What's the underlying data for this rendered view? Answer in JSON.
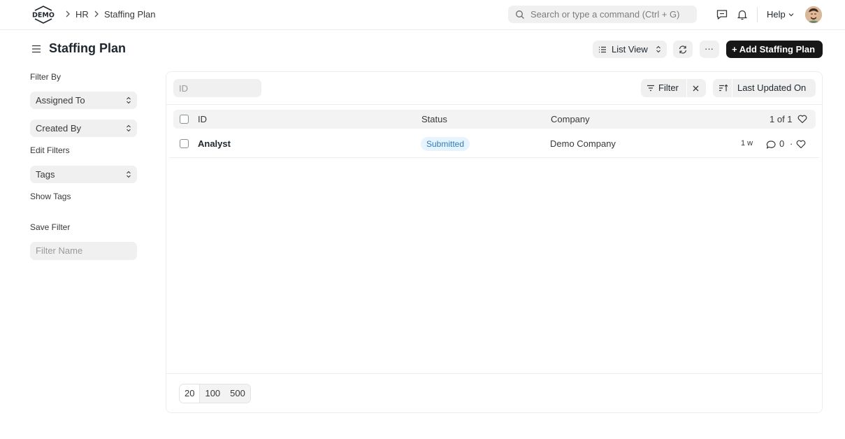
{
  "navbar": {
    "logo_text": "DEMO",
    "breadcrumbs": [
      "HR",
      "Staffing Plan"
    ],
    "search_placeholder": "Search or type a command (Ctrl + G)",
    "help_label": "Help"
  },
  "page": {
    "title": "Staffing Plan",
    "list_view_label": "List View",
    "more_label": "···",
    "add_button_label": "+ Add Staffing Plan"
  },
  "sidebar": {
    "filter_by_label": "Filter By",
    "assigned_to_label": "Assigned To",
    "created_by_label": "Created By",
    "edit_filters_label": "Edit Filters",
    "tags_label": "Tags",
    "show_tags_label": "Show Tags",
    "save_filter_label": "Save Filter",
    "filter_name_placeholder": "Filter Name"
  },
  "list": {
    "id_filter_placeholder": "ID",
    "filter_label": "Filter",
    "sort_label": "Last Updated On",
    "columns": {
      "id": "ID",
      "status": "Status",
      "company": "Company"
    },
    "count_label": "1 of 1",
    "rows": [
      {
        "id": "Analyst",
        "status": "Submitted",
        "company": "Demo Company",
        "modified": "1 w",
        "comments": "0",
        "dot": "·"
      }
    ],
    "page_sizes": [
      "20",
      "100",
      "500"
    ]
  }
}
